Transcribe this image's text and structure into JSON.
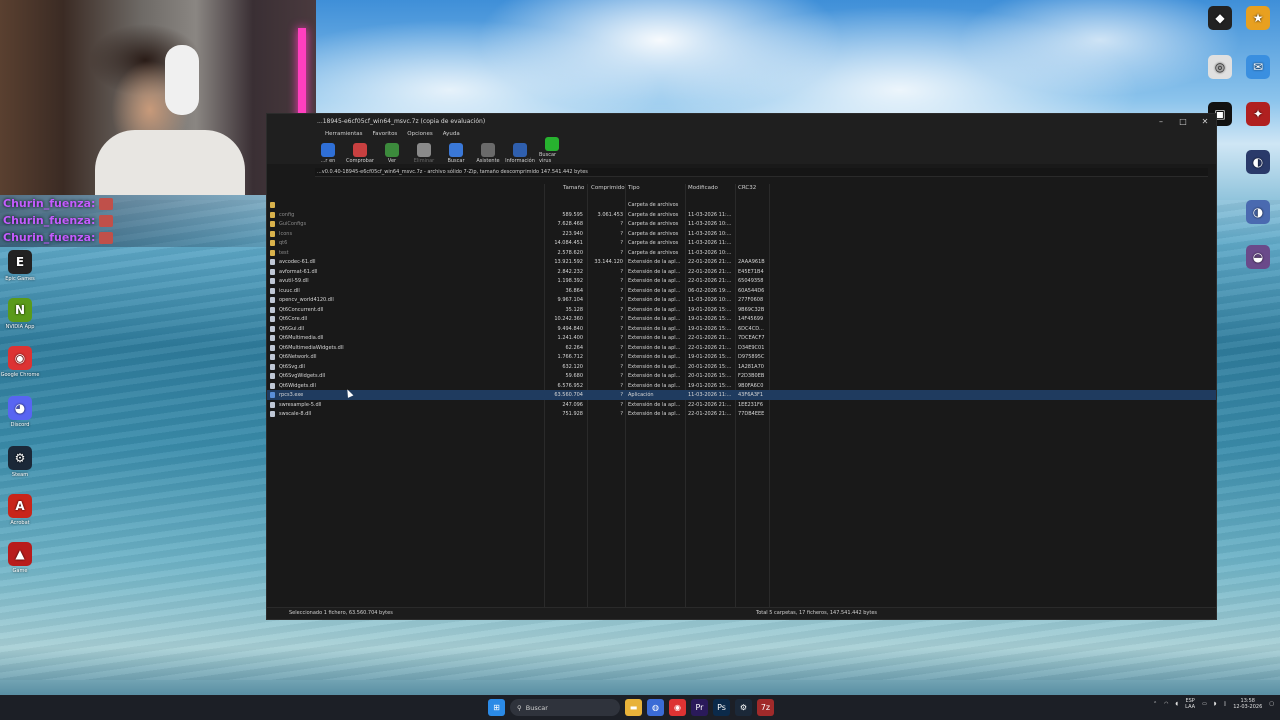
{
  "window": {
    "title": "...18945-e6cf05cf_win64_msvc.7z (copia de evaluación)",
    "controls": {
      "minimize": "–",
      "maximize": "□",
      "close": "✕"
    },
    "menu": [
      "Herramientas",
      "Favoritos",
      "Opciones",
      "Ayuda"
    ],
    "toolbar": [
      {
        "label": "...r en",
        "icon": "extract-icon",
        "color": "#2f6fd6",
        "enabled": true
      },
      {
        "label": "Comprobar",
        "icon": "check-icon",
        "color": "#c84040",
        "enabled": true
      },
      {
        "label": "Ver",
        "icon": "view-icon",
        "color": "#3c8a3c",
        "enabled": true
      },
      {
        "label": "Eliminar",
        "icon": "delete-icon",
        "color": "#8a8a8a",
        "enabled": false
      },
      {
        "label": "Buscar",
        "icon": "search-icon",
        "color": "#3a78d8",
        "enabled": true
      },
      {
        "label": "Asistente",
        "icon": "wizard-icon",
        "color": "#6a6a6a",
        "enabled": true
      },
      {
        "label": "Información",
        "icon": "info-icon",
        "color": "#2f5fae",
        "enabled": true
      },
      {
        "label": "Buscar virus",
        "icon": "virus-scan-icon",
        "color": "#27b22f",
        "enabled": true
      }
    ],
    "path": "...v0.0.40-18945-e6cf05cf_win64_msvc.7z - archivo sólido 7-Zip, tamaño descomprimido 147.541.442 bytes",
    "columns": [
      "Tamaño",
      "Comprimido",
      "Tipo",
      "Modificado",
      "CRC32"
    ],
    "rows": [
      {
        "name": "",
        "kind": "folder",
        "size": "",
        "packed": "",
        "type": "Carpeta de archivos",
        "modified": "",
        "crc": ""
      },
      {
        "name": "config",
        "kind": "folder",
        "size": "589.595",
        "packed": "3.061.453",
        "type": "Carpeta de archivos",
        "modified": "11-03-2026 11:...",
        "crc": ""
      },
      {
        "name": "GuiConfigs",
        "kind": "folder",
        "size": "7.628.468",
        "packed": "?",
        "type": "Carpeta de archivos",
        "modified": "11-03-2026 10:...",
        "crc": ""
      },
      {
        "name": "Icons",
        "kind": "folder",
        "size": "223.940",
        "packed": "?",
        "type": "Carpeta de archivos",
        "modified": "11-03-2026 10:...",
        "crc": ""
      },
      {
        "name": "qt6",
        "kind": "folder",
        "size": "14.084.451",
        "packed": "?",
        "type": "Carpeta de archivos",
        "modified": "11-03-2026 11:...",
        "crc": ""
      },
      {
        "name": "test",
        "kind": "folder",
        "size": "2.578.620",
        "packed": "?",
        "type": "Carpeta de archivos",
        "modified": "11-03-2026 10:...",
        "crc": ""
      },
      {
        "name": "avcodec-61.dll",
        "kind": "dll",
        "size": "13.921.592",
        "packed": "33.144.120",
        "type": "Extensión de la apl...",
        "modified": "22-01-2026 21:...",
        "crc": "2AAA961B"
      },
      {
        "name": "avformat-61.dll",
        "kind": "dll",
        "size": "2.842.232",
        "packed": "?",
        "type": "Extensión de la apl...",
        "modified": "22-01-2026 21:...",
        "crc": "E45E71B4"
      },
      {
        "name": "avutil-59.dll",
        "kind": "dll",
        "size": "1.198.392",
        "packed": "?",
        "type": "Extensión de la apl...",
        "modified": "22-01-2026 21:...",
        "crc": "65049358"
      },
      {
        "name": "icuuc.dll",
        "kind": "dll",
        "size": "36.864",
        "packed": "?",
        "type": "Extensión de la apl...",
        "modified": "06-02-2026 19:...",
        "crc": "60A544D6"
      },
      {
        "name": "opencv_world4120.dll",
        "kind": "dll",
        "size": "9.967.104",
        "packed": "?",
        "type": "Extensión de la apl...",
        "modified": "11-03-2026 10:...",
        "crc": "277F0608"
      },
      {
        "name": "Qt6Concurrent.dll",
        "kind": "dll",
        "size": "35.128",
        "packed": "?",
        "type": "Extensión de la apl...",
        "modified": "19-01-2026 15:...",
        "crc": "9B69C32B"
      },
      {
        "name": "Qt6Core.dll",
        "kind": "dll",
        "size": "10.242.360",
        "packed": "?",
        "type": "Extensión de la apl...",
        "modified": "19-01-2026 15:...",
        "crc": "14F45699"
      },
      {
        "name": "Qt6Gui.dll",
        "kind": "dll",
        "size": "9.494.840",
        "packed": "?",
        "type": "Extensión de la apl...",
        "modified": "19-01-2026 15:...",
        "crc": "6DC4CD..."
      },
      {
        "name": "Qt6Multimedia.dll",
        "kind": "dll",
        "size": "1.241.400",
        "packed": "?",
        "type": "Extensión de la apl...",
        "modified": "22-01-2026 21:...",
        "crc": "7DCEACF7"
      },
      {
        "name": "Qt6MultimediaWidgets.dll",
        "kind": "dll",
        "size": "62.264",
        "packed": "?",
        "type": "Extensión de la apl...",
        "modified": "22-01-2026 21:...",
        "crc": "D34E9C01"
      },
      {
        "name": "Qt6Network.dll",
        "kind": "dll",
        "size": "1.766.712",
        "packed": "?",
        "type": "Extensión de la apl...",
        "modified": "19-01-2026 15:...",
        "crc": "D975895C"
      },
      {
        "name": "Qt6Svg.dll",
        "kind": "dll",
        "size": "632.120",
        "packed": "?",
        "type": "Extensión de la apl...",
        "modified": "20-01-2026 15:...",
        "crc": "1A281A70"
      },
      {
        "name": "Qt6SvgWidgets.dll",
        "kind": "dll",
        "size": "59.680",
        "packed": "?",
        "type": "Extensión de la apl...",
        "modified": "20-01-2026 15:...",
        "crc": "F2D3B0EB"
      },
      {
        "name": "Qt6Widgets.dll",
        "kind": "dll",
        "size": "6.576.952",
        "packed": "?",
        "type": "Extensión de la apl...",
        "modified": "19-01-2026 15:...",
        "crc": "9B0FA6C0"
      },
      {
        "name": "rpcs3.exe",
        "kind": "exe",
        "size": "63.560.704",
        "packed": "?",
        "type": "Aplicación",
        "modified": "11-03-2026 11:...",
        "crc": "43F6A3F1",
        "selected": true
      },
      {
        "name": "swresample-5.dll",
        "kind": "dll",
        "size": "247.096",
        "packed": "?",
        "type": "Extensión de la apl...",
        "modified": "22-01-2026 21:...",
        "crc": "1EE231F6"
      },
      {
        "name": "swscale-8.dll",
        "kind": "dll",
        "size": "751.928",
        "packed": "?",
        "type": "Extensión de la apl...",
        "modified": "22-01-2026 21:...",
        "crc": "77DB4EEE"
      }
    ],
    "status_left": "Seleccionado 1 fichero, 63.560.704 bytes",
    "status_right": "Total 5 carpetas, 17 ficheros, 147.541.442 bytes"
  },
  "chat": [
    {
      "user": "Churin_fuenza:"
    },
    {
      "user": "Churin_fuenza:"
    },
    {
      "user": "Churin_fuenza:"
    }
  ],
  "desktop_left": [
    {
      "label": "Epic Games",
      "icon": "epic-games-icon",
      "color": "#222",
      "glyph": "E"
    },
    {
      "label": "NVIDIA App",
      "icon": "nvidia-icon",
      "color": "#5a9a1a",
      "glyph": "N"
    },
    {
      "label": "Google Chrome",
      "icon": "chrome-icon",
      "color": "#d33",
      "glyph": "◉"
    },
    {
      "label": "Discord",
      "icon": "discord-icon",
      "color": "#5865f2",
      "glyph": "◕"
    },
    {
      "label": "Steam",
      "icon": "steam-icon",
      "color": "#1b2838",
      "glyph": "⚙"
    },
    {
      "label": "Acrobat",
      "icon": "acrobat-icon",
      "color": "#c8251a",
      "glyph": "A"
    },
    {
      "label": "Game",
      "icon": "game-icon",
      "color": "#b81c1c",
      "glyph": "▲"
    }
  ],
  "taskbar": {
    "search_placeholder": "Buscar",
    "apps": [
      {
        "icon": "windows-start-icon",
        "color": "#2b8ae6",
        "glyph": "⊞"
      },
      {
        "icon": "file-explorer-icon",
        "color": "#e8b23a",
        "glyph": "▬"
      },
      {
        "icon": "browser-icon",
        "color": "#3b6bd6",
        "glyph": "◍"
      },
      {
        "icon": "chrome-icon",
        "color": "#d33",
        "glyph": "◉"
      },
      {
        "icon": "premiere-icon",
        "color": "#2a1a5a",
        "glyph": "Pr"
      },
      {
        "icon": "photoshop-icon",
        "color": "#0b2a4a",
        "glyph": "Ps"
      },
      {
        "icon": "steam-icon",
        "color": "#1b2838",
        "glyph": "⚙"
      },
      {
        "icon": "7zip-icon",
        "color": "#a02a2a",
        "glyph": "7z"
      }
    ],
    "lang_top": "ESP",
    "lang_bottom": "LAA",
    "time": "13:58",
    "date": "12-03-2026"
  }
}
